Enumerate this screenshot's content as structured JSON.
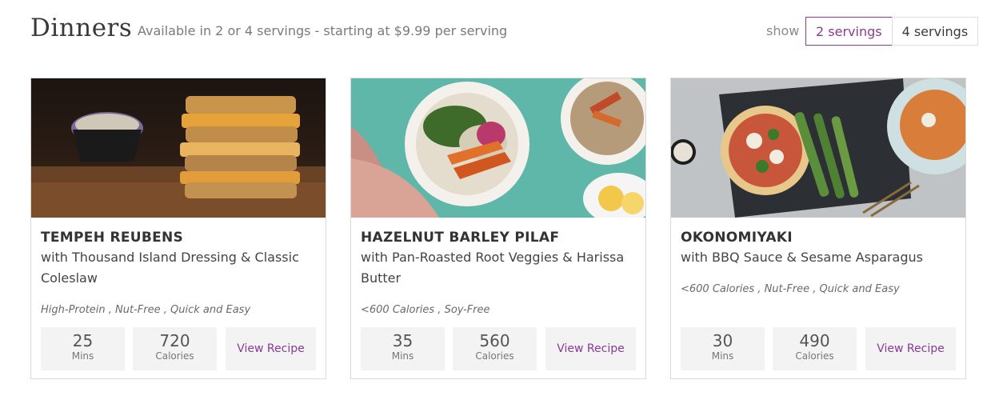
{
  "header": {
    "title": "Dinners",
    "subtitle": "Available in 2 or 4 servings - starting at $9.99 per serving",
    "show_label": "show",
    "servings_options": [
      "2 servings",
      "4 servings"
    ],
    "selected_servings": "2 servings"
  },
  "accent_color": "#8a3a94",
  "recipes": [
    {
      "title": "TEMPEH REUBENS",
      "description": "with Thousand Island Dressing & Classic Coleslaw",
      "tags": "High-Protein , Nut-Free , Quick and Easy",
      "mins": "25",
      "mins_label": "Mins",
      "calories": "720",
      "calories_label": "Calories",
      "button": "View Recipe"
    },
    {
      "title": "HAZELNUT BARLEY PILAF",
      "description": "with Pan-Roasted Root Veggies & Harissa Butter",
      "tags": "<600 Calories , Soy-Free",
      "mins": "35",
      "mins_label": "Mins",
      "calories": "560",
      "calories_label": "Calories",
      "button": "View Recipe"
    },
    {
      "title": "OKONOMIYAKI",
      "description": "with BBQ Sauce & Sesame Asparagus",
      "tags": "<600 Calories , Nut-Free , Quick and Easy",
      "mins": "30",
      "mins_label": "Mins",
      "calories": "490",
      "calories_label": "Calories",
      "button": "View Recipe"
    }
  ]
}
